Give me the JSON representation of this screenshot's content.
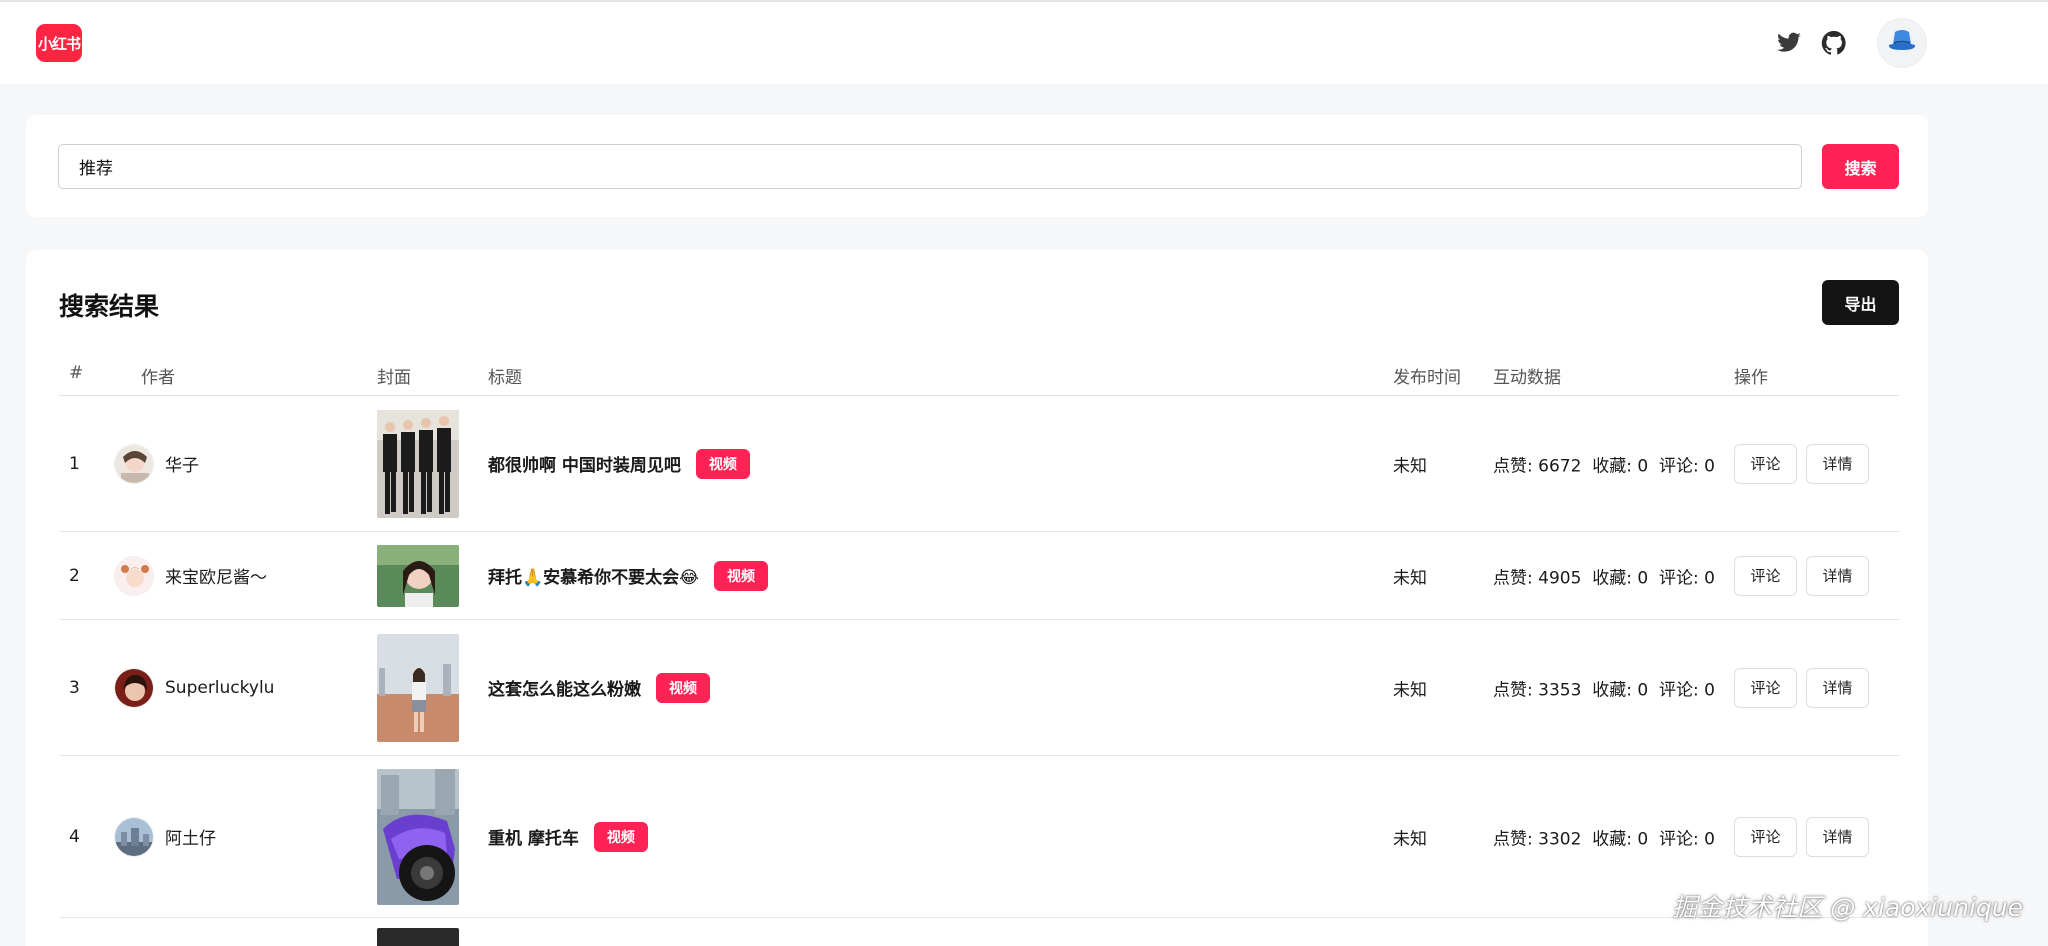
{
  "header": {
    "logo_text": "小红书",
    "icons": [
      "twitter-icon",
      "github-icon",
      "bucket-hat-icon"
    ]
  },
  "search": {
    "value": "推荐",
    "button_label": "搜索"
  },
  "results": {
    "title": "搜索结果",
    "export_label": "导出",
    "columns": {
      "index": "#",
      "author": "作者",
      "cover": "封面",
      "title": "标题",
      "time": "发布时间",
      "stats": "互动数据",
      "ops": "操作"
    },
    "rows": [
      {
        "index": "1",
        "author": "华子",
        "title": "都很帅啊 中国时装周见吧",
        "tag": "视频",
        "time": "未知",
        "stats": "点赞: 6672  收藏: 0  评论: 0",
        "comment_label": "评论",
        "detail_label": "详情"
      },
      {
        "index": "2",
        "author": "来宝欧尼酱～",
        "title": "拜托🙏安慕希你不要太会😂",
        "tag": "视频",
        "time": "未知",
        "stats": "点赞: 4905  收藏: 0  评论: 0",
        "comment_label": "评论",
        "detail_label": "详情"
      },
      {
        "index": "3",
        "author": "Superluckylu",
        "title": "这套怎么能这么粉嫩",
        "tag": "视频",
        "time": "未知",
        "stats": "点赞: 3353  收藏: 0  评论: 0",
        "comment_label": "评论",
        "detail_label": "详情"
      },
      {
        "index": "4",
        "author": "阿土仔",
        "title": "重机 摩托车",
        "tag": "视频",
        "time": "未知",
        "stats": "点赞: 3302  收藏: 0  评论: 0",
        "comment_label": "评论",
        "detail_label": "详情"
      }
    ]
  },
  "watermark": "掘金技术社区 @ xiaoxiunique",
  "colors": {
    "brand_red": "#ff2442",
    "tag_red": "#ff2255",
    "export_black": "#141414"
  }
}
